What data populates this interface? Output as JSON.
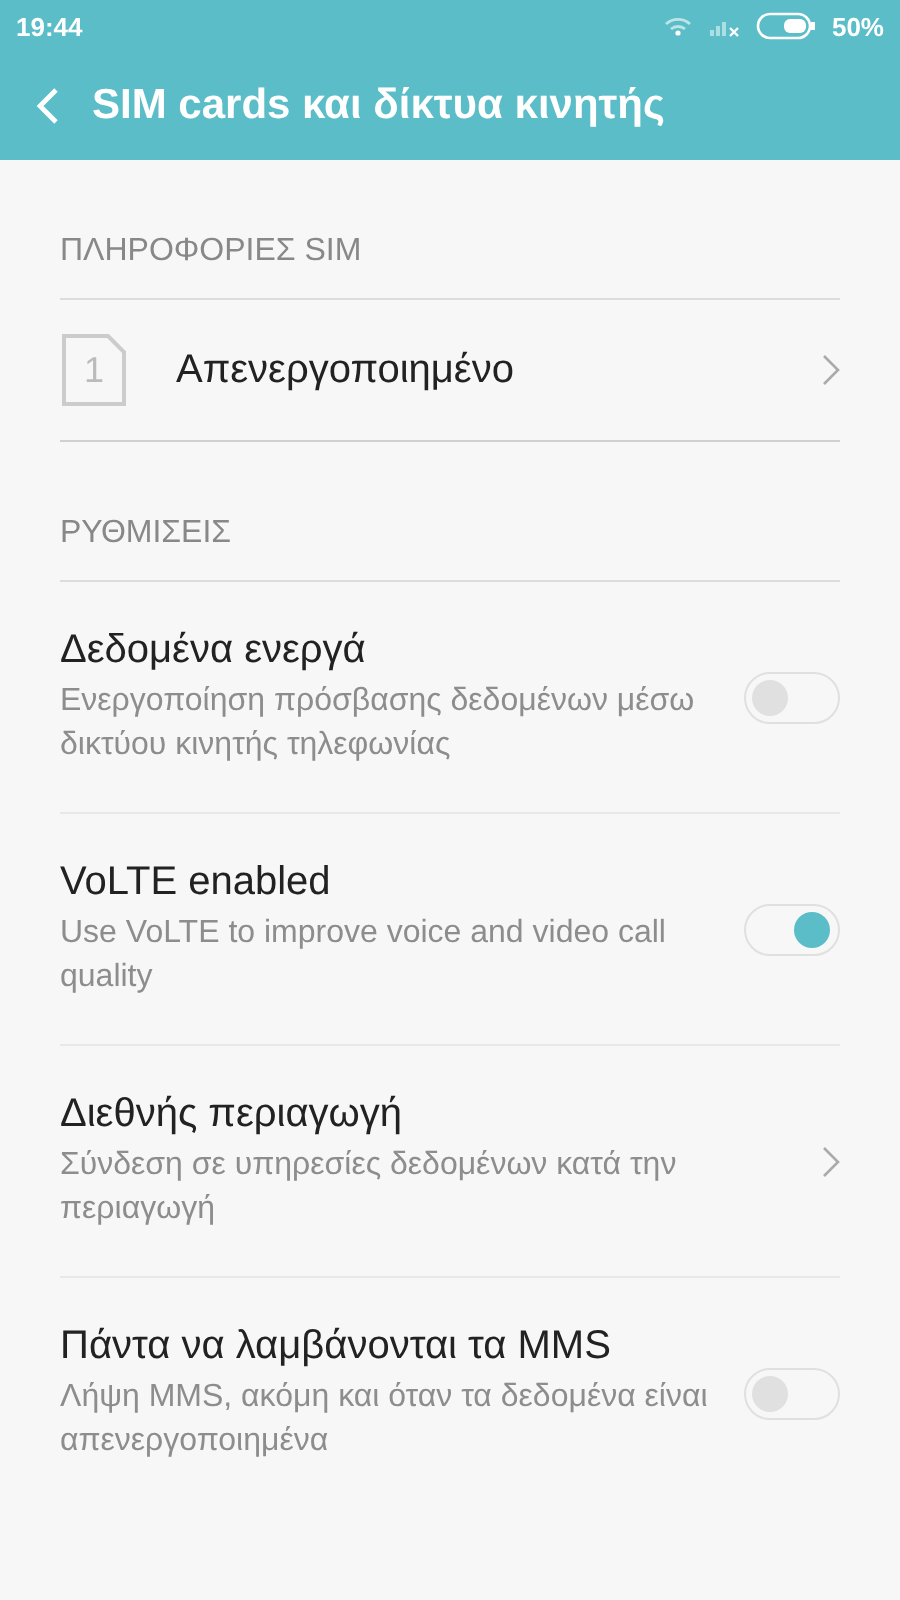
{
  "status_bar": {
    "time": "19:44",
    "battery": "50%"
  },
  "header": {
    "title": "SIM cards και δίκτυα κινητής"
  },
  "sections": [
    {
      "title": "ΠΛΗΡΟΦΟΡΙΕΣ SIM",
      "items": [
        {
          "kind": "sim",
          "sim_number": "1",
          "title": "Απενεργοποιημένο"
        }
      ]
    },
    {
      "title": "ΡΥΘΜΙΣΕΙΣ",
      "items": [
        {
          "kind": "toggle",
          "title": "Δεδομένα ενεργά",
          "subtitle": "Ενεργοποίηση πρόσβασης δεδομένων μέσω δικτύου κινητής τηλεφωνίας",
          "on": false
        },
        {
          "kind": "toggle",
          "title": "VoLTE enabled",
          "subtitle": "Use VoLTE to improve voice and video call quality",
          "on": true
        },
        {
          "kind": "link",
          "title": "Διεθνής περιαγωγή",
          "subtitle": "Σύνδεση σε υπηρεσίες δεδομένων κατά την περιαγωγή"
        },
        {
          "kind": "toggle",
          "title": "Πάντα να λαμβάνονται τα MMS",
          "subtitle": "Λήψη MMS, ακόμη και όταν τα δεδομένα είναι απενεργοποιημένα",
          "on": false
        }
      ]
    }
  ]
}
